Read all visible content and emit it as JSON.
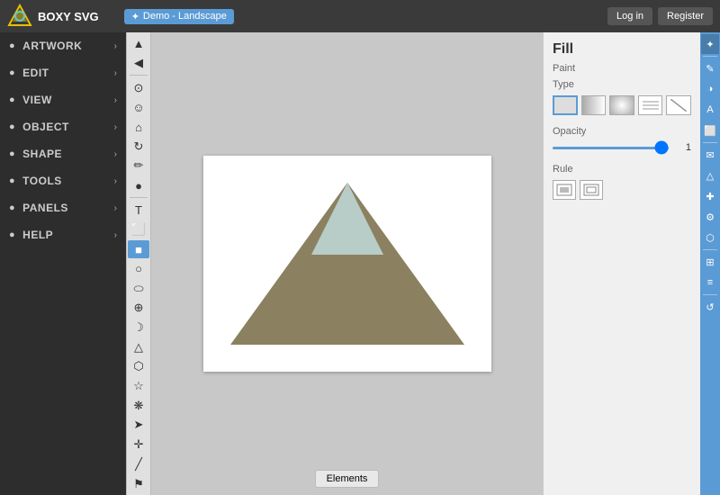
{
  "topbar": {
    "logo_text": "BOXY SVG",
    "demo_badge": "Demo - Landscape"
  },
  "auth": {
    "login": "Log in",
    "register": "Register"
  },
  "nav": {
    "items": [
      {
        "label": "ARTWORK",
        "id": "artwork"
      },
      {
        "label": "EDIT",
        "id": "edit"
      },
      {
        "label": "VIEW",
        "id": "view"
      },
      {
        "label": "OBJECT",
        "id": "object"
      },
      {
        "label": "SHAPE",
        "id": "shape"
      },
      {
        "label": "TOOLS",
        "id": "tools"
      },
      {
        "label": "PANELS",
        "id": "panels"
      },
      {
        "label": "HELP",
        "id": "help"
      }
    ]
  },
  "tools": [
    {
      "icon": "▲",
      "name": "select-tool",
      "title": "Select"
    },
    {
      "icon": "◀",
      "name": "pointer-tool",
      "title": "Pointer"
    },
    {
      "icon": "⊙",
      "name": "transform-tool",
      "title": "Transform"
    },
    {
      "icon": "☺",
      "name": "node-tool",
      "title": "Node"
    },
    {
      "icon": "⌂",
      "name": "path-tool",
      "title": "Path"
    },
    {
      "icon": "↻",
      "name": "rotate-tool",
      "title": "Rotate"
    },
    {
      "icon": "✏",
      "name": "pen-tool",
      "title": "Pen"
    },
    {
      "icon": "●",
      "name": "pencil-tool",
      "title": "Pencil"
    },
    {
      "icon": "T",
      "name": "text-tool",
      "title": "Text"
    },
    {
      "icon": "⬜",
      "name": "crop-tool",
      "title": "Crop"
    },
    {
      "icon": "■",
      "name": "rect-active-tool",
      "title": "Rectangle",
      "active": true
    },
    {
      "icon": "○",
      "name": "circle-tool",
      "title": "Circle"
    },
    {
      "icon": "⬭",
      "name": "ellipse-tool",
      "title": "Ellipse"
    },
    {
      "icon": "⊕",
      "name": "target-tool",
      "title": "Target"
    },
    {
      "icon": "☽",
      "name": "arc-tool",
      "title": "Arc"
    },
    {
      "icon": "△",
      "name": "triangle-tool",
      "title": "Triangle"
    },
    {
      "icon": "⬡",
      "name": "polygon-tool",
      "title": "Polygon"
    },
    {
      "icon": "☆",
      "name": "star-tool",
      "title": "Star"
    },
    {
      "icon": "❋",
      "name": "flower-tool",
      "title": "Flower"
    },
    {
      "icon": "➤",
      "name": "arrow-tool",
      "title": "Arrow"
    },
    {
      "icon": "✛",
      "name": "cross-tool",
      "title": "Cross"
    },
    {
      "icon": "╱",
      "name": "line-tool",
      "title": "Line"
    },
    {
      "icon": "⚑",
      "name": "flag-tool",
      "title": "Flag"
    }
  ],
  "right_panel": {
    "title": "Fill",
    "paint_label": "Paint",
    "type_label": "Type",
    "opacity_label": "Opacity",
    "opacity_value": "1",
    "rule_label": "Rule",
    "type_options": [
      "solid",
      "linear",
      "radial",
      "pattern",
      "none"
    ],
    "rule_options": [
      "nonzero",
      "evenodd"
    ]
  },
  "far_right": {
    "tools": [
      {
        "icon": "✦",
        "name": "fr-select"
      },
      {
        "icon": "✎",
        "name": "fr-edit"
      },
      {
        "icon": "◑",
        "name": "fr-fill"
      },
      {
        "icon": "A",
        "name": "fr-text"
      },
      {
        "icon": "⬜",
        "name": "fr-rect"
      },
      {
        "icon": "✉",
        "name": "fr-mail"
      },
      {
        "icon": "△",
        "name": "fr-triangle"
      },
      {
        "icon": "✚",
        "name": "fr-add"
      },
      {
        "icon": "⚙",
        "name": "fr-settings"
      },
      {
        "icon": "⬡",
        "name": "fr-hex"
      },
      {
        "icon": "⊞",
        "name": "fr-grid"
      },
      {
        "icon": "≡",
        "name": "fr-list"
      },
      {
        "icon": "↺",
        "name": "fr-undo"
      }
    ]
  },
  "canvas": {
    "elements_tab": "Elements"
  }
}
